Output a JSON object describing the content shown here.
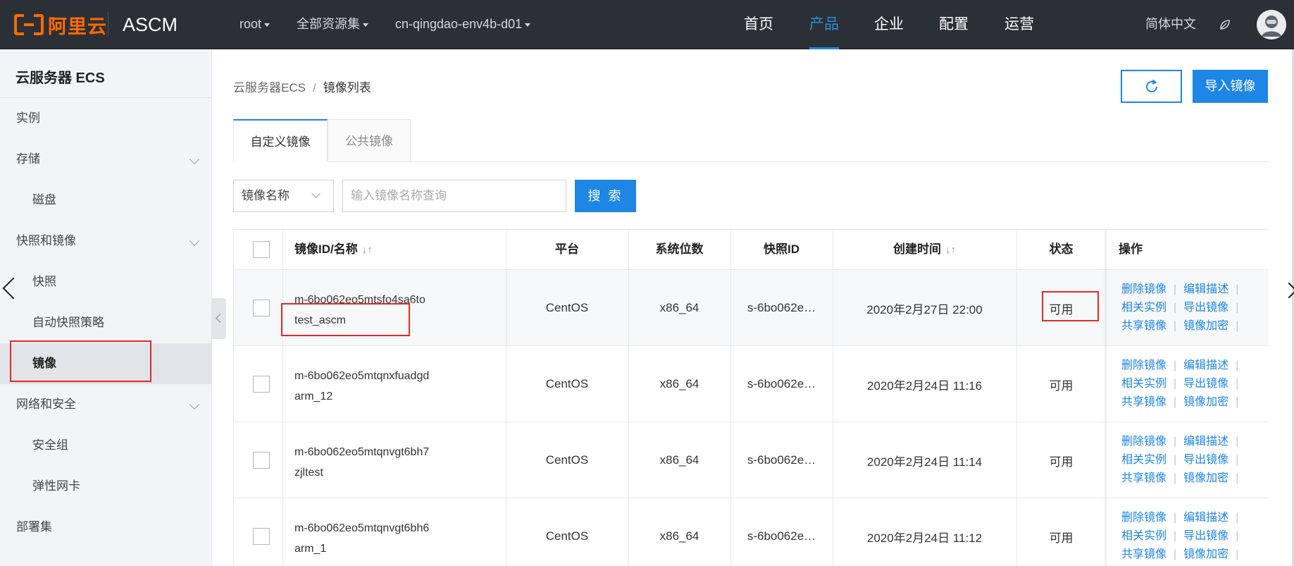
{
  "header": {
    "logo_text": "阿里云",
    "app_name": "ASCM",
    "dropdowns": [
      {
        "label": "root"
      },
      {
        "label": "全部资源集"
      },
      {
        "label": "cn-qingdao-env4b-d01"
      }
    ],
    "nav": [
      {
        "label": "首页",
        "active": false
      },
      {
        "label": "产品",
        "active": true
      },
      {
        "label": "企业",
        "active": false
      },
      {
        "label": "配置",
        "active": false
      },
      {
        "label": "运营",
        "active": false
      }
    ],
    "language": "简体中文",
    "accent": "#1e86e4",
    "brand": "#ff6a00"
  },
  "sidebar": {
    "title": "云服务器 ECS",
    "items": [
      {
        "label": "实例",
        "level": 1,
        "expandable": false
      },
      {
        "label": "存储",
        "level": 1,
        "expandable": true
      },
      {
        "label": "磁盘",
        "level": 2,
        "expandable": false
      },
      {
        "label": "快照和镜像",
        "level": 1,
        "expandable": true
      },
      {
        "label": "快照",
        "level": 2,
        "expandable": false
      },
      {
        "label": "自动快照策略",
        "level": 2,
        "expandable": false
      },
      {
        "label": "镜像",
        "level": 2,
        "expandable": false,
        "selected": true
      },
      {
        "label": "网络和安全",
        "level": 1,
        "expandable": true
      },
      {
        "label": "安全组",
        "level": 2,
        "expandable": false
      },
      {
        "label": "弹性网卡",
        "level": 2,
        "expandable": false
      },
      {
        "label": "部署集",
        "level": 1,
        "expandable": false
      }
    ]
  },
  "breadcrumb": {
    "parent": "云服务器ECS",
    "separator": "/",
    "current": "镜像列表"
  },
  "toolbar": {
    "refresh_icon": "refresh-icon",
    "import_label": "导入镜像"
  },
  "tabs": [
    {
      "label": "自定义镜像",
      "active": true
    },
    {
      "label": "公共镜像",
      "active": false
    }
  ],
  "search": {
    "field_select": "镜像名称",
    "placeholder": "输入镜像名称查询",
    "value": "",
    "button_label": "搜 索"
  },
  "table": {
    "headers": {
      "id_name": "镜像ID/名称",
      "platform": "平台",
      "arch": "系统位数",
      "snapshot": "快照ID",
      "created": "创建时间",
      "status": "状态",
      "ops": "操作"
    },
    "sort_icon": "↓↑",
    "rows": [
      {
        "id": "m-6bo062eo5mtsfo4sa6to",
        "name": "test_ascm",
        "platform": "CentOS",
        "arch": "x86_64",
        "snapshot": "s-6bo062e…",
        "created": "2020年2月27日 22:00",
        "status": "可用"
      },
      {
        "id": "m-6bo062eo5mtqnxfuadgd",
        "name": "arm_12",
        "platform": "CentOS",
        "arch": "x86_64",
        "snapshot": "s-6bo062e…",
        "created": "2020年2月24日 11:16",
        "status": "可用"
      },
      {
        "id": "m-6bo062eo5mtqnvgt6bh7",
        "name": "zjltest",
        "platform": "CentOS",
        "arch": "x86_64",
        "snapshot": "s-6bo062e…",
        "created": "2020年2月24日 11:14",
        "status": "可用"
      },
      {
        "id": "m-6bo062eo5mtqnvgt6bh6",
        "name": "arm_1",
        "platform": "CentOS",
        "arch": "x86_64",
        "snapshot": "s-6bo062e…",
        "created": "2020年2月24日 11:12",
        "status": "可用"
      }
    ],
    "ops": {
      "line1": [
        "删除镜像",
        "编辑描述"
      ],
      "line2": [
        "相关实例",
        "导出镜像"
      ],
      "line3": [
        "共享镜像",
        "镜像加密"
      ],
      "separator": "|"
    }
  },
  "annotation_color": "#e42828"
}
